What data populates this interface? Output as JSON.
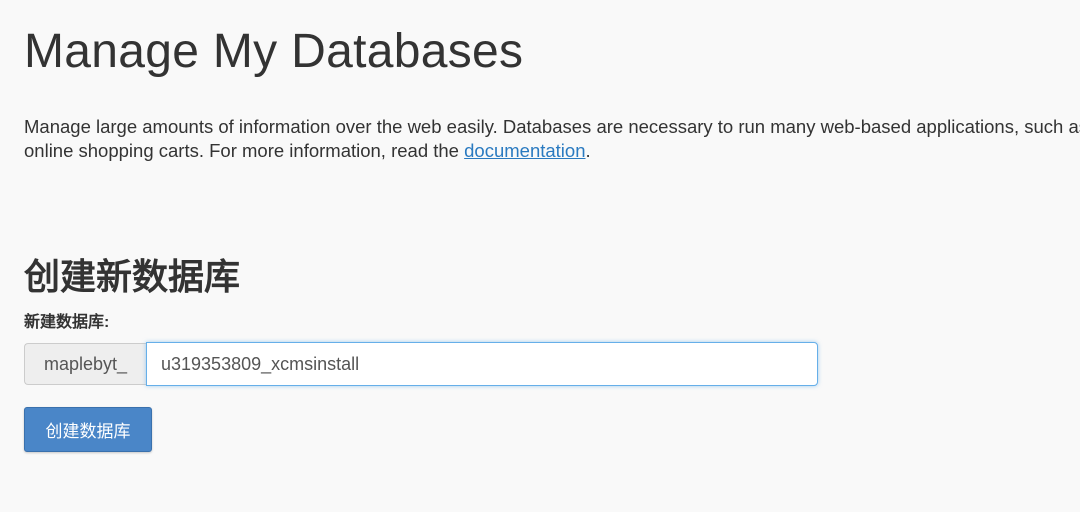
{
  "page": {
    "title": "Manage My Databases",
    "description_line1": "Manage large amounts of information over the web easily. Databases are necessary to run many web-based applications, such as",
    "description_line2_prefix": "online shopping carts. For more information, read the ",
    "description_link": "documentation",
    "description_line2_suffix": "."
  },
  "create_db": {
    "section_title": "创建新数据库",
    "field_label": "新建数据库:",
    "prefix": "maplebyt_",
    "input_value": "u319353809_xcmsinstall",
    "button_label": "创建数据库"
  },
  "colors": {
    "link": "#2a7ac0",
    "button": "#4a86c8",
    "focus_border": "#66afe9"
  }
}
